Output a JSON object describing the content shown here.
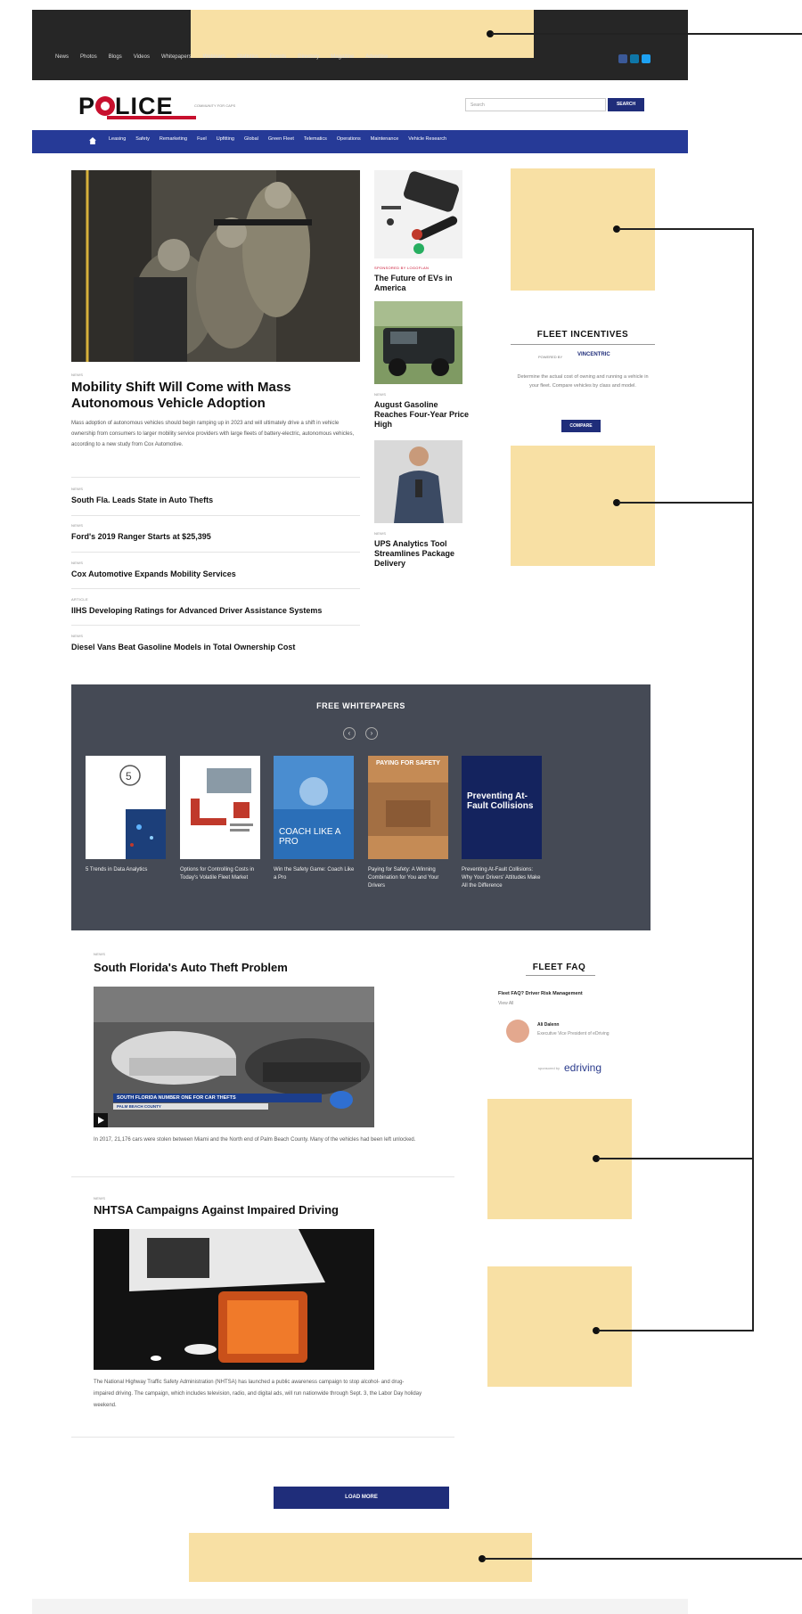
{
  "topnav": [
    "News",
    "Photos",
    "Blogs",
    "Videos",
    "Whitepapers",
    "Webinars",
    "Statistics",
    "Events",
    "Directory",
    "Magazine",
    "Advertise"
  ],
  "brand": {
    "logo": "POLICE",
    "tagline": "COMMUNITY FOR CAPS"
  },
  "search": {
    "placeholder": "Search",
    "button": "SEARCH"
  },
  "mainnav": [
    "Leasing",
    "Safety",
    "Remarketing",
    "Fuel",
    "Upfitting",
    "Global",
    "Green Fleet",
    "Telematics",
    "Operations",
    "Maintenance",
    "Vehicle Research"
  ],
  "hero": {
    "label": "NEWS",
    "title": "Mobility Shift Will Come with Mass Autonomous Vehicle Adoption",
    "summary": "Mass adoption of autonomous vehicles should begin ramping up in 2023 and will ultimately drive a shift in vehicle ownership from consumers to larger mobility service providers with large fleets of battery-electric, autonomous vehicles, according to a new study from Cox Automotive."
  },
  "headlines": [
    {
      "label": "NEWS",
      "title": "South Fla. Leads State in Auto Thefts"
    },
    {
      "label": "NEWS",
      "title": "Ford's 2019 Ranger Starts at $25,395"
    },
    {
      "label": "NEWS",
      "title": "Cox Automotive Expands Mobility Services"
    },
    {
      "label": "ARTICLE",
      "title": "IIHS Developing Ratings for Advanced Driver Assistance Systems"
    },
    {
      "label": "NEWS",
      "title": "Diesel Vans Beat Gasoline Models in Total Ownership Cost"
    }
  ],
  "midcol": [
    {
      "label": "SPONSORED BY LOGOFLAN",
      "title": "The Future of EVs in America"
    },
    {
      "label": "NEWS",
      "title": "August Gasoline Reaches Four-Year Price High"
    },
    {
      "label": "NEWS",
      "title": "UPS Analytics Tool Streamlines Package Delivery"
    }
  ],
  "incentives": {
    "title": "FLEET INCENTIVES",
    "powered": "POWERED BY",
    "brand": "VINCENTRIC",
    "text": "Determine the actual cost of owning and running a vehicle in your fleet. Compare vehicles by class and model.",
    "button": "COMPARE"
  },
  "whitepapers": {
    "title": "FREE WHITEPAPERS",
    "items": [
      {
        "caption": "5 Trends in Data Analytics"
      },
      {
        "caption": "Options for Controlling Costs in Today's Volatile Fleet Market"
      },
      {
        "caption": "Win the Safety Game: Coach Like a Pro",
        "cover": "COACH LIKE A PRO"
      },
      {
        "caption": "Paying for Safety: A Winning Combination for You and Your Drivers",
        "cover": "PAYING FOR SAFETY"
      },
      {
        "caption": "Preventing At-Fault Collisions: Why Your Drivers' Attitudes Make All the Difference",
        "cover": "Preventing At-Fault Collisions"
      }
    ]
  },
  "articles": [
    {
      "label": "NEWS",
      "title": "South Florida's Auto Theft Problem",
      "summary": "In 2017, 21,176 cars were stolen between Miami and the North end of Palm Beach County. Many of the vehicles had been left unlocked.",
      "banner": "SOUTH FLORIDA NUMBER ONE FOR CAR THEFTS",
      "banner2": "PALM BEACH COUNTY"
    },
    {
      "label": "NEWS",
      "title": "NHTSA Campaigns Against Impaired Driving",
      "summary": "The National Highway Traffic Safety Administration (NHTSA) has launched a public awareness campaign to stop alcohol- and drug-impaired driving. The campaign, which includes television, radio, and digital ads, will run nationwide through Sept. 3, the Labor Day holiday weekend."
    }
  ],
  "faq": {
    "title": "FLEET FAQ",
    "question": "Fleet FAQ? Driver Risk Management",
    "link": "View All",
    "person": "Ali Dalenn",
    "role": "Executive Vice President of eDriving",
    "sponsor": "sponsored by",
    "sponsor_brand": "edriving"
  },
  "loadmore": "LOAD MORE",
  "colors": {
    "ad": "#f8e0a4",
    "nav": "#263a97",
    "button": "#1f2d7a",
    "whitepapers": "#454a55"
  }
}
